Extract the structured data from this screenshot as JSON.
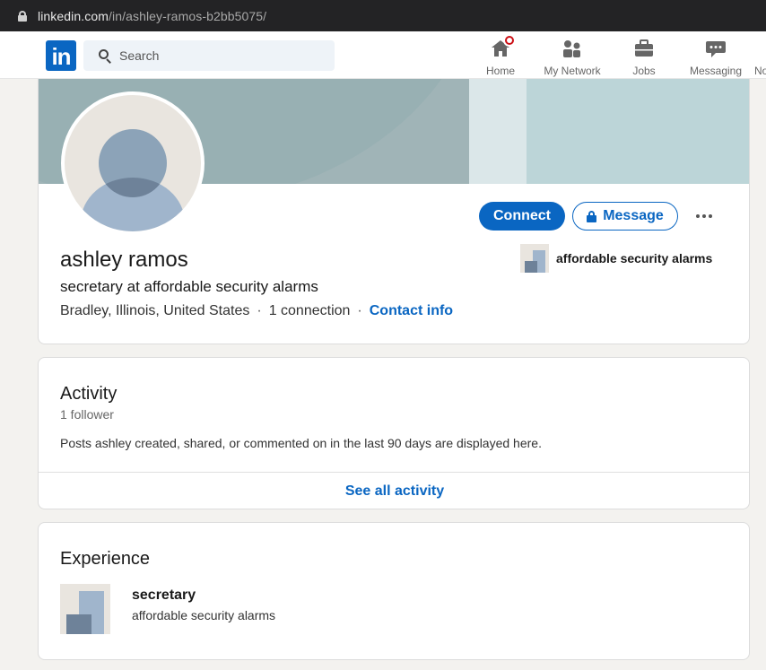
{
  "browser": {
    "url_host": "linkedin.com",
    "url_path": "/in/ashley-ramos-b2bb5075/"
  },
  "nav": {
    "logo_text": "in",
    "search_placeholder": "Search",
    "items": [
      {
        "label": "Home",
        "icon": "home-icon",
        "has_badge": true
      },
      {
        "label": "My Network",
        "icon": "network-icon"
      },
      {
        "label": "Jobs",
        "icon": "briefcase-icon"
      },
      {
        "label": "Messaging",
        "icon": "messaging-icon"
      },
      {
        "label": "No",
        "icon": "bell-icon"
      }
    ]
  },
  "colors": {
    "brand": "#0a66c2",
    "badge": "#cc1016",
    "page_bg": "#f3f2ef"
  },
  "profile": {
    "name": "ashley ramos",
    "headline": "secretary at affordable security alarms",
    "location": "Bradley, Illinois, United States",
    "connections": "1 connection",
    "contact_info": "Contact info",
    "separator": "·",
    "current_company": "affordable security alarms",
    "actions": {
      "connect": "Connect",
      "message": "Message"
    }
  },
  "activity": {
    "title": "Activity",
    "followers": "1 follower",
    "description": "Posts ashley created, shared, or commented on in the last 90 days are displayed here.",
    "see_all": "See all activity"
  },
  "experience": {
    "title": "Experience",
    "items": [
      {
        "role": "secretary",
        "company": "affordable security alarms"
      }
    ]
  }
}
